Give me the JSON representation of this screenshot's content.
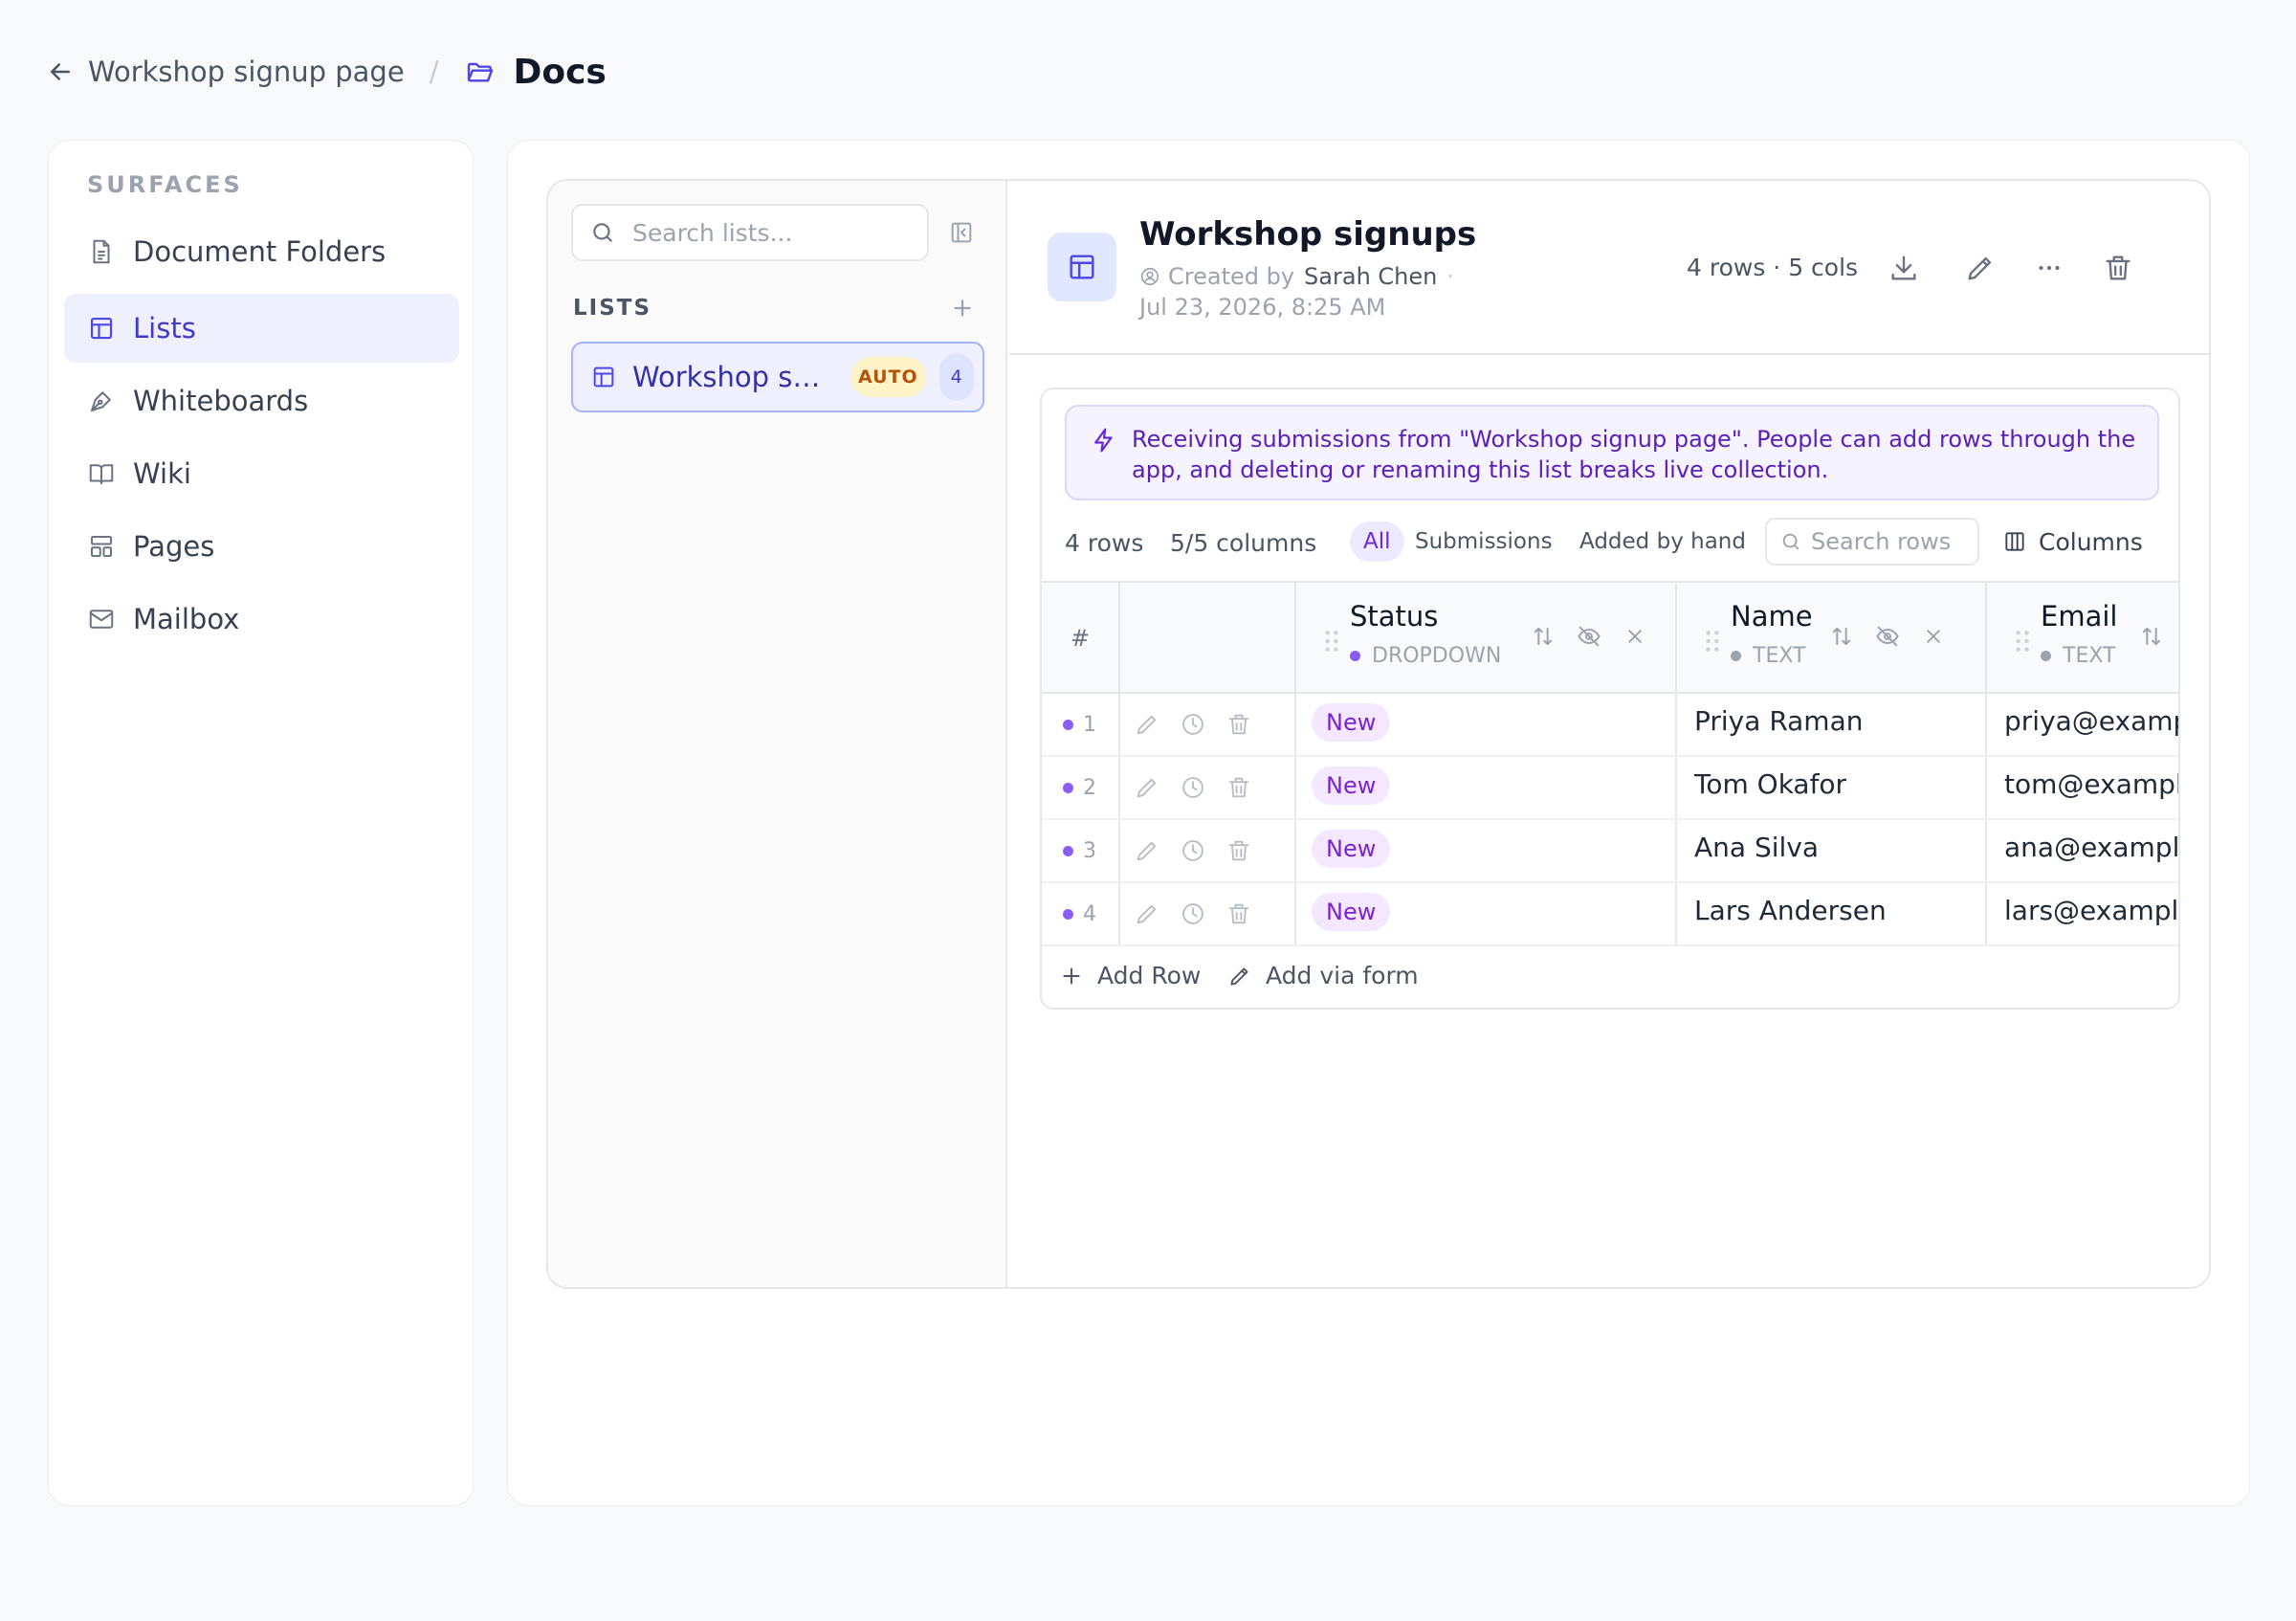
{
  "breadcrumb": {
    "parent": "Workshop signup page",
    "separator": "/",
    "current": "Docs"
  },
  "sidebar": {
    "heading": "SURFACES",
    "items": [
      {
        "label": "Document Folders",
        "icon": "document-icon",
        "active": false
      },
      {
        "label": "Lists",
        "icon": "table-icon",
        "active": true
      },
      {
        "label": "Whiteboards",
        "icon": "pen-nib-icon",
        "active": false
      },
      {
        "label": "Wiki",
        "icon": "book-icon",
        "active": false
      },
      {
        "label": "Pages",
        "icon": "layout-icon",
        "active": false
      },
      {
        "label": "Mailbox",
        "icon": "mail-icon",
        "active": false
      }
    ]
  },
  "lists_panel": {
    "search_placeholder": "Search lists...",
    "heading": "LISTS",
    "items": [
      {
        "name": "Workshop signups",
        "badge": "AUTO",
        "count": "4"
      }
    ]
  },
  "detail": {
    "title": "Workshop signups",
    "created_by_label": "Created by",
    "author": "Sarah Chen",
    "meta_separator": "·",
    "created_at": "Jul 23, 2026, 8:25 AM",
    "summary": "4 rows · 5 cols",
    "actions": [
      "download-icon",
      "edit-icon",
      "more-icon",
      "trash-icon"
    ]
  },
  "banner": {
    "text": "Receiving submissions from \"Workshop signup page\". People can add rows through the app, and deleting or renaming this list breaks live collection."
  },
  "toolbar": {
    "rows": "4 rows",
    "separator": "·",
    "columns": "5/5 columns",
    "filters": [
      "All",
      "Submissions",
      "Added by hand"
    ],
    "active_filter": "All",
    "search_placeholder": "Search rows",
    "columns_button": "Columns"
  },
  "table": {
    "index_header": "#",
    "columns": [
      {
        "name": "Status",
        "type": "DROPDOWN",
        "type_color": "#8b5cf6"
      },
      {
        "name": "Name",
        "type": "TEXT",
        "type_color": "#9ca3af"
      },
      {
        "name": "Email",
        "type": "TEXT",
        "type_color": "#9ca3af"
      }
    ],
    "rows": [
      {
        "index": "1",
        "status": "New",
        "name": "Priya Raman",
        "email": "priya@example.com"
      },
      {
        "index": "2",
        "status": "New",
        "name": "Tom Okafor",
        "email": "tom@example.com"
      },
      {
        "index": "3",
        "status": "New",
        "name": "Ana Silva",
        "email": "ana@example.com"
      },
      {
        "index": "4",
        "status": "New",
        "name": "Lars Andersen",
        "email": "lars@example.com"
      }
    ],
    "add_row_label": "Add Row",
    "add_form_label": "Add via form"
  }
}
